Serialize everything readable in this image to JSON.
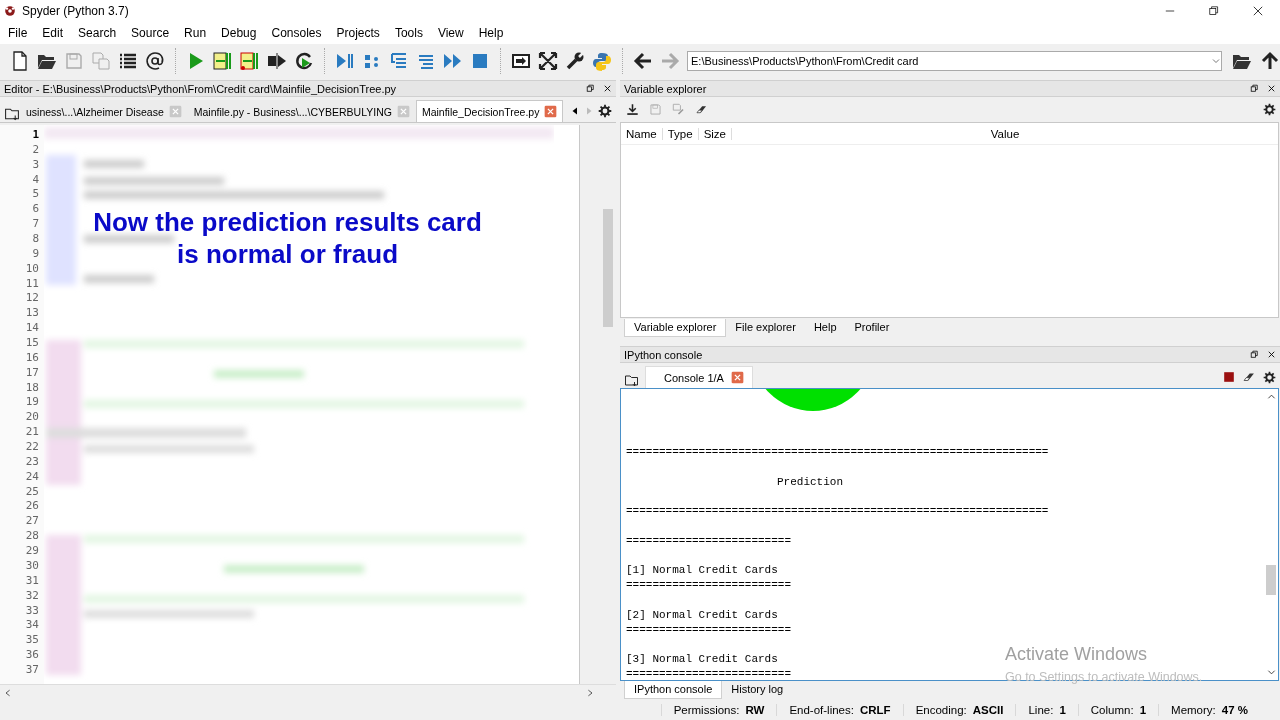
{
  "window": {
    "title": "Spyder (Python 3.7)"
  },
  "menu": [
    "File",
    "Edit",
    "Search",
    "Source",
    "Run",
    "Debug",
    "Consoles",
    "Projects",
    "Tools",
    "View",
    "Help"
  ],
  "toolbar": {
    "path": "E:\\Business\\Products\\Python\\From\\Credit card"
  },
  "editor": {
    "title": "Editor - E:\\Business\\Products\\Python\\From\\Credit card\\Mainfile_DecisionTree.py",
    "tabs": [
      {
        "label": "usiness\\...\\Alzheimer Disease",
        "selected": false
      },
      {
        "label": "Mainfile.py - Business\\...\\CYBERBULYING",
        "selected": false
      },
      {
        "label": "Mainfile_DecisionTree.py",
        "selected": true
      }
    ],
    "lines": [
      {
        "number": "1",
        "current": true
      },
      {
        "number": "2",
        "current": false
      },
      {
        "number": "3",
        "current": false
      },
      {
        "number": "4",
        "current": false
      },
      {
        "number": "5",
        "current": false
      },
      {
        "number": "6",
        "current": false
      },
      {
        "number": "7",
        "current": false
      },
      {
        "number": "8",
        "current": false
      },
      {
        "number": "9",
        "current": false
      },
      {
        "number": "10",
        "current": false
      },
      {
        "number": "11",
        "current": false
      },
      {
        "number": "12",
        "current": false
      },
      {
        "number": "13",
        "current": false
      },
      {
        "number": "14",
        "current": false
      },
      {
        "number": "15",
        "current": false
      },
      {
        "number": "16",
        "current": false
      },
      {
        "number": "17",
        "current": false
      },
      {
        "number": "18",
        "current": false
      },
      {
        "number": "19",
        "current": false
      },
      {
        "number": "20",
        "current": false
      },
      {
        "number": "21",
        "current": false
      },
      {
        "number": "22",
        "current": false
      },
      {
        "number": "23",
        "current": false
      },
      {
        "number": "24",
        "current": false
      },
      {
        "number": "25",
        "current": false
      },
      {
        "number": "26",
        "current": false
      },
      {
        "number": "27",
        "current": false
      },
      {
        "number": "28",
        "current": false
      },
      {
        "number": "29",
        "current": false
      },
      {
        "number": "30",
        "current": false
      },
      {
        "number": "31",
        "current": false
      },
      {
        "number": "32",
        "current": false
      },
      {
        "number": "33",
        "current": false
      },
      {
        "number": "34",
        "current": false
      },
      {
        "number": "35",
        "current": false
      },
      {
        "number": "36",
        "current": false
      },
      {
        "number": "37",
        "current": false
      }
    ],
    "caption": "Now the prediction results card\nis normal or fraud"
  },
  "variable_explorer": {
    "title": "Variable explorer",
    "columns": [
      "Name",
      "Type",
      "Size",
      "Value"
    ]
  },
  "top_tabs": [
    {
      "label": "Variable explorer",
      "selected": true
    },
    {
      "label": "File explorer",
      "selected": false
    },
    {
      "label": "Help",
      "selected": false
    },
    {
      "label": "Profiler",
      "selected": false
    }
  ],
  "console_pane": {
    "title": "IPython console",
    "tabs": [
      {
        "label": "Console 1/A",
        "selected": true
      }
    ],
    "output": [
      {
        "kind": "rule",
        "text": "================================================================"
      },
      {
        "kind": "blank"
      },
      {
        "kind": "heading",
        "text": "Prediction"
      },
      {
        "kind": "blank"
      },
      {
        "kind": "rule",
        "text": "================================================================"
      },
      {
        "kind": "blank"
      },
      {
        "kind": "rule",
        "text": "========================="
      },
      {
        "kind": "blank"
      },
      {
        "kind": "text",
        "text": "[1] Normal Credit Cards"
      },
      {
        "kind": "rule",
        "text": "========================="
      },
      {
        "kind": "blank"
      },
      {
        "kind": "text",
        "text": "[2] Normal Credit Cards"
      },
      {
        "kind": "rule",
        "text": "========================="
      },
      {
        "kind": "blank"
      },
      {
        "kind": "text",
        "text": "[3] Normal Credit Cards"
      },
      {
        "kind": "rule",
        "text": "========================="
      }
    ]
  },
  "bottom_tabs": [
    {
      "label": "IPython console",
      "selected": true
    },
    {
      "label": "History log",
      "selected": false
    }
  ],
  "status_bar": [
    {
      "label": "Permissions:",
      "value": "RW"
    },
    {
      "label": "End-of-lines:",
      "value": "CRLF"
    },
    {
      "label": "Encoding:",
      "value": "ASCII"
    },
    {
      "label": "Line:",
      "value": "1"
    },
    {
      "label": "Column:",
      "value": "1"
    },
    {
      "label": "Memory:",
      "value": "47 %"
    }
  ],
  "os_notice": {
    "title": "Activate Windows",
    "subtitle": "Go to Settings to activate Windows."
  }
}
